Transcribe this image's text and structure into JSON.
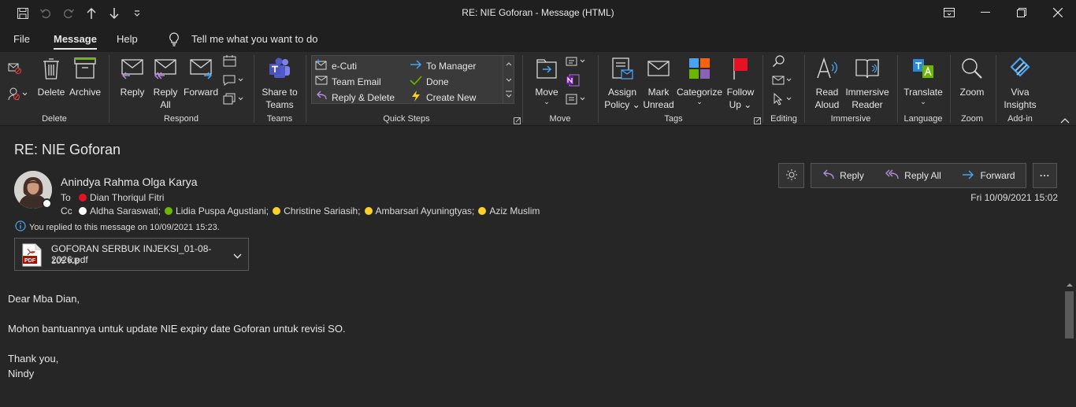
{
  "window": {
    "title": "RE: NIE Goforan  -  Message (HTML)"
  },
  "menu": {
    "tabs": [
      "File",
      "Message",
      "Help"
    ],
    "active": "Message",
    "search_placeholder": "Tell me what you want to do"
  },
  "ribbon": {
    "groups": {
      "delete": "Delete",
      "respond": "Respond",
      "teams": "Teams",
      "quick_steps": "Quick Steps",
      "move": "Move",
      "tags": "Tags",
      "editing": "Editing",
      "immersive": "Immersive",
      "language": "Language",
      "zoom": "Zoom",
      "addin": "Add-in"
    },
    "buttons": {
      "delete": "Delete",
      "archive": "Archive",
      "reply": "Reply",
      "reply_all_1": "Reply",
      "reply_all_2": "All",
      "forward": "Forward",
      "share_teams_1": "Share to",
      "share_teams_2": "Teams",
      "move": "Move",
      "assign_1": "Assign",
      "assign_2": "Policy",
      "mark_1": "Mark",
      "mark_2": "Unread",
      "categorize": "Categorize",
      "follow_1": "Follow",
      "follow_2": "Up",
      "read_1": "Read",
      "read_2": "Aloud",
      "immersive_1": "Immersive",
      "immersive_2": "Reader",
      "translate": "Translate",
      "zoom": "Zoom",
      "viva_1": "Viva",
      "viva_2": "Insights"
    },
    "quick_steps": {
      "col1": [
        "e-Cuti",
        "Team Email",
        "Reply & Delete"
      ],
      "col2": [
        "To Manager",
        "Done",
        "Create New"
      ]
    }
  },
  "message": {
    "subject": "RE: NIE Goforan",
    "sender": "Anindya Rahma Olga Karya",
    "to_label": "To",
    "cc_label": "Cc",
    "to": [
      {
        "name": "Dian Thoriqul Fitri",
        "status": "#e81123"
      }
    ],
    "cc": [
      {
        "name": "Aldha Saraswati;",
        "status": "#ffffff"
      },
      {
        "name": "Lidia Puspa Agustiani;",
        "status": "#6bb700"
      },
      {
        "name": "Christine Sariasih;",
        "status": "#f8d22a"
      },
      {
        "name": "Ambarsari Ayuningtyas;",
        "status": "#f8d22a"
      },
      {
        "name": "Aziz Muslim",
        "status": "#f8d22a"
      }
    ],
    "info_bar": "You replied to this message on 10/09/2021 15:23.",
    "date": "Fri 10/09/2021 15:02",
    "attachment": {
      "name": "GOFORAN SERBUK INJEKSI_01-08-2026.pdf",
      "size": "105 KB",
      "icon": "pdf-icon"
    },
    "actions": {
      "reply": "Reply",
      "reply_all": "Reply All",
      "forward": "Forward",
      "more": "..."
    },
    "body": [
      "Dear Mba Dian,",
      "Mohon bantuannya untuk update NIE expiry date Goforan untuk revisi SO.",
      "Thank you,",
      "Nindy"
    ]
  },
  "colors": {
    "accent_purple": "#b58ad9",
    "accent_blue": "#4aa3f0",
    "background": "#262626"
  }
}
